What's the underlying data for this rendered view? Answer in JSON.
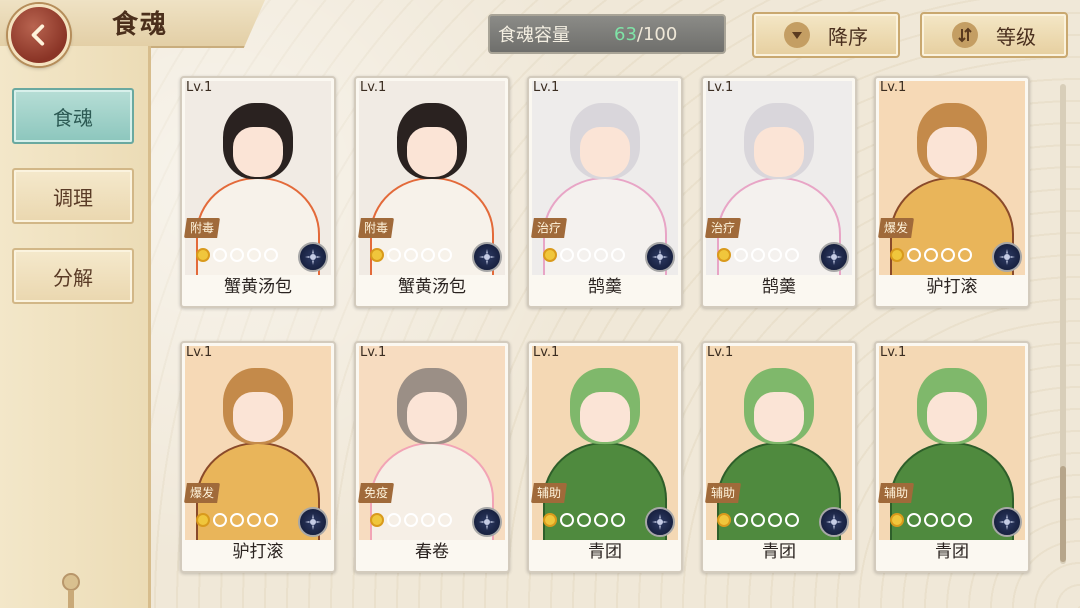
{
  "header": {
    "title": "食魂",
    "back_icon": "back-arrow-icon"
  },
  "sidebar": {
    "items": [
      {
        "label": "食魂",
        "active": true
      },
      {
        "label": "调理",
        "active": false
      },
      {
        "label": "分解",
        "active": false
      }
    ]
  },
  "capacity": {
    "label": "食魂容量",
    "current": "63",
    "max": "/100"
  },
  "sort": {
    "order_label": "降序",
    "order_icon": "triangle-down-icon",
    "type_label": "等级",
    "type_icon": "sort-arrows-icon"
  },
  "cards": [
    {
      "level": "Lv.1",
      "tag": "附毒",
      "name": "蟹黄汤包",
      "stars_on": 1,
      "stars_total": 5,
      "theme": "white"
    },
    {
      "level": "Lv.1",
      "tag": "附毒",
      "name": "蟹黄汤包",
      "stars_on": 1,
      "stars_total": 5,
      "theme": "white"
    },
    {
      "level": "Lv.1",
      "tag": "治疗",
      "name": "鹄羹",
      "stars_on": 1,
      "stars_total": 5,
      "theme": "silver"
    },
    {
      "level": "Lv.1",
      "tag": "治疗",
      "name": "鹄羹",
      "stars_on": 1,
      "stars_total": 5,
      "theme": "silver"
    },
    {
      "level": "Lv.1",
      "tag": "爆发",
      "name": "驴打滚",
      "stars_on": 1,
      "stars_total": 5,
      "theme": "orange"
    },
    {
      "level": "Lv.1",
      "tag": "爆发",
      "name": "驴打滚",
      "stars_on": 1,
      "stars_total": 5,
      "theme": "orange"
    },
    {
      "level": "Lv.1",
      "tag": "免疫",
      "name": "春卷",
      "stars_on": 1,
      "stars_total": 5,
      "theme": "flower"
    },
    {
      "level": "Lv.1",
      "tag": "辅助",
      "name": "青团",
      "stars_on": 1,
      "stars_total": 5,
      "theme": "green"
    },
    {
      "level": "Lv.1",
      "tag": "辅助",
      "name": "青团",
      "stars_on": 1,
      "stars_total": 5,
      "theme": "green"
    },
    {
      "level": "Lv.1",
      "tag": "辅助",
      "name": "青团",
      "stars_on": 1,
      "stars_total": 5,
      "theme": "green"
    }
  ],
  "themes": {
    "white": {
      "bg": "#f1ebe4",
      "hair": "#2a2220",
      "body": "#f7f2ea",
      "accent": "#e36a3a"
    },
    "silver": {
      "bg": "#eeeceb",
      "hair": "#d9d6db",
      "body": "#f4f1ee",
      "accent": "#e8a5c6"
    },
    "orange": {
      "bg": "#f6d9b6",
      "hair": "#c48a4a",
      "body": "#e9b55a",
      "accent": "#8a4a2a"
    },
    "flower": {
      "bg": "#f7dcc0",
      "hair": "#9b8f86",
      "body": "#f6efe6",
      "accent": "#f2a4b5"
    },
    "green": {
      "bg": "#f4d8b4",
      "hair": "#7fb86b",
      "body": "#4f8a3e",
      "accent": "#2e5f2a"
    }
  }
}
